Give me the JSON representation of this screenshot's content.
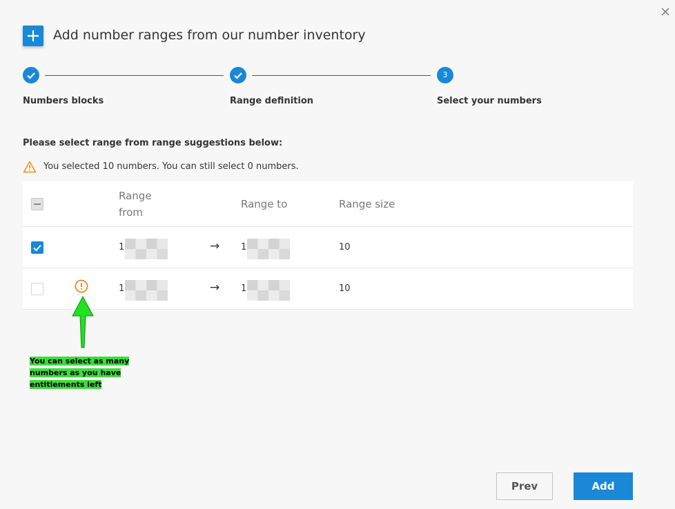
{
  "dialog": {
    "title": "Add number ranges from our number inventory",
    "close_icon": "close-icon",
    "accent_color": "#1a88d6"
  },
  "steps": [
    {
      "label": "Numbers blocks",
      "state": "completed"
    },
    {
      "label": "Range definition",
      "state": "completed"
    },
    {
      "label": "Select your numbers",
      "state": "active",
      "number": "3"
    }
  ],
  "instruction": "Please select range from range suggestions below:",
  "warning": {
    "text": "You selected 10 numbers. You can still select 0 numbers.",
    "color": "#f0901a"
  },
  "table": {
    "headers": {
      "range_from": "Range from",
      "range_to": "Range to",
      "range_size": "Range size"
    },
    "rows": [
      {
        "checked": true,
        "from": "1",
        "to": "1",
        "size": "10",
        "alert": false
      },
      {
        "checked": false,
        "from": "1",
        "to": "1",
        "size": "10",
        "alert": true
      }
    ]
  },
  "annotation": "You can select as many numbers as you have entitlements left",
  "footer": {
    "prev_label": "Prev",
    "add_label": "Add"
  }
}
